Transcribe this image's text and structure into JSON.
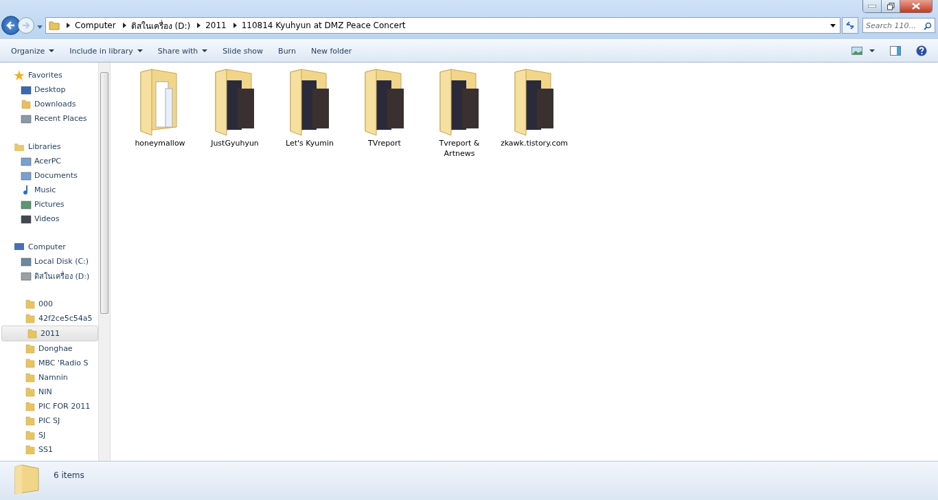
{
  "address": {
    "crumbs": [
      "Computer",
      "ดิสในเครื่อง (D:)",
      "2011",
      "110814 Kyuhyun at DMZ Peace Concert"
    ]
  },
  "search": {
    "placeholder": "Search 110..."
  },
  "toolbar": [
    {
      "label": "Organize",
      "dropdown": true
    },
    {
      "label": "Include in library",
      "dropdown": true
    },
    {
      "label": "Share with",
      "dropdown": true
    },
    {
      "label": "Slide show",
      "dropdown": false
    },
    {
      "label": "Burn",
      "dropdown": false
    },
    {
      "label": "New folder",
      "dropdown": false
    }
  ],
  "nav": [
    {
      "title": "Favorites",
      "kind": "star",
      "items": [
        {
          "label": "Desktop",
          "kind": "desktop",
          "selected": false
        },
        {
          "label": "Downloads",
          "kind": "download",
          "selected": false
        },
        {
          "label": "Recent Places",
          "kind": "recent",
          "selected": false
        }
      ]
    },
    {
      "title": "Libraries",
      "kind": "library",
      "items": [
        {
          "label": "AcerPC",
          "kind": "doc",
          "selected": false
        },
        {
          "label": "Documents",
          "kind": "doc",
          "selected": false
        },
        {
          "label": "Music",
          "kind": "music",
          "selected": false
        },
        {
          "label": "Pictures",
          "kind": "picture",
          "selected": false
        },
        {
          "label": "Videos",
          "kind": "video",
          "selected": false
        }
      ]
    },
    {
      "title": "Computer",
      "kind": "computer",
      "items": [
        {
          "label": "Local Disk (C:)",
          "kind": "disk",
          "selected": false
        },
        {
          "label": "ดิสในเครื่อง (D:)",
          "kind": "drive",
          "selected": false
        }
      ]
    },
    {
      "kind": "none",
      "items": [
        {
          "label": "000",
          "kind": "folder",
          "selected": false
        },
        {
          "label": "42f2ce5c54a5",
          "kind": "folder",
          "selected": false
        },
        {
          "label": "2011",
          "kind": "folder",
          "selected": true
        },
        {
          "label": "Donghae",
          "kind": "folder",
          "selected": false
        },
        {
          "label": "MBC 'Radio S",
          "kind": "folder",
          "selected": false
        },
        {
          "label": "Namnin",
          "kind": "folder",
          "selected": false
        },
        {
          "label": "NIN",
          "kind": "folder",
          "selected": false
        },
        {
          "label": "PIC FOR 2011",
          "kind": "folder",
          "selected": false
        },
        {
          "label": "PIC SJ",
          "kind": "folder",
          "selected": false
        },
        {
          "label": "SJ",
          "kind": "folder",
          "selected": false
        },
        {
          "label": "SS1",
          "kind": "folder",
          "selected": false
        }
      ]
    }
  ],
  "folders": [
    {
      "name": "honeymallow",
      "kind": "documents"
    },
    {
      "name": "JustGyuhyun",
      "kind": "photos"
    },
    {
      "name": "Let's Kyumin",
      "kind": "photos"
    },
    {
      "name": "TVreport",
      "kind": "photos"
    },
    {
      "name": "Tvreport & Artnews",
      "kind": "photos"
    },
    {
      "name": "zkawk.tistory.com",
      "kind": "photos"
    }
  ],
  "status_bar": {
    "count": "6 items"
  }
}
